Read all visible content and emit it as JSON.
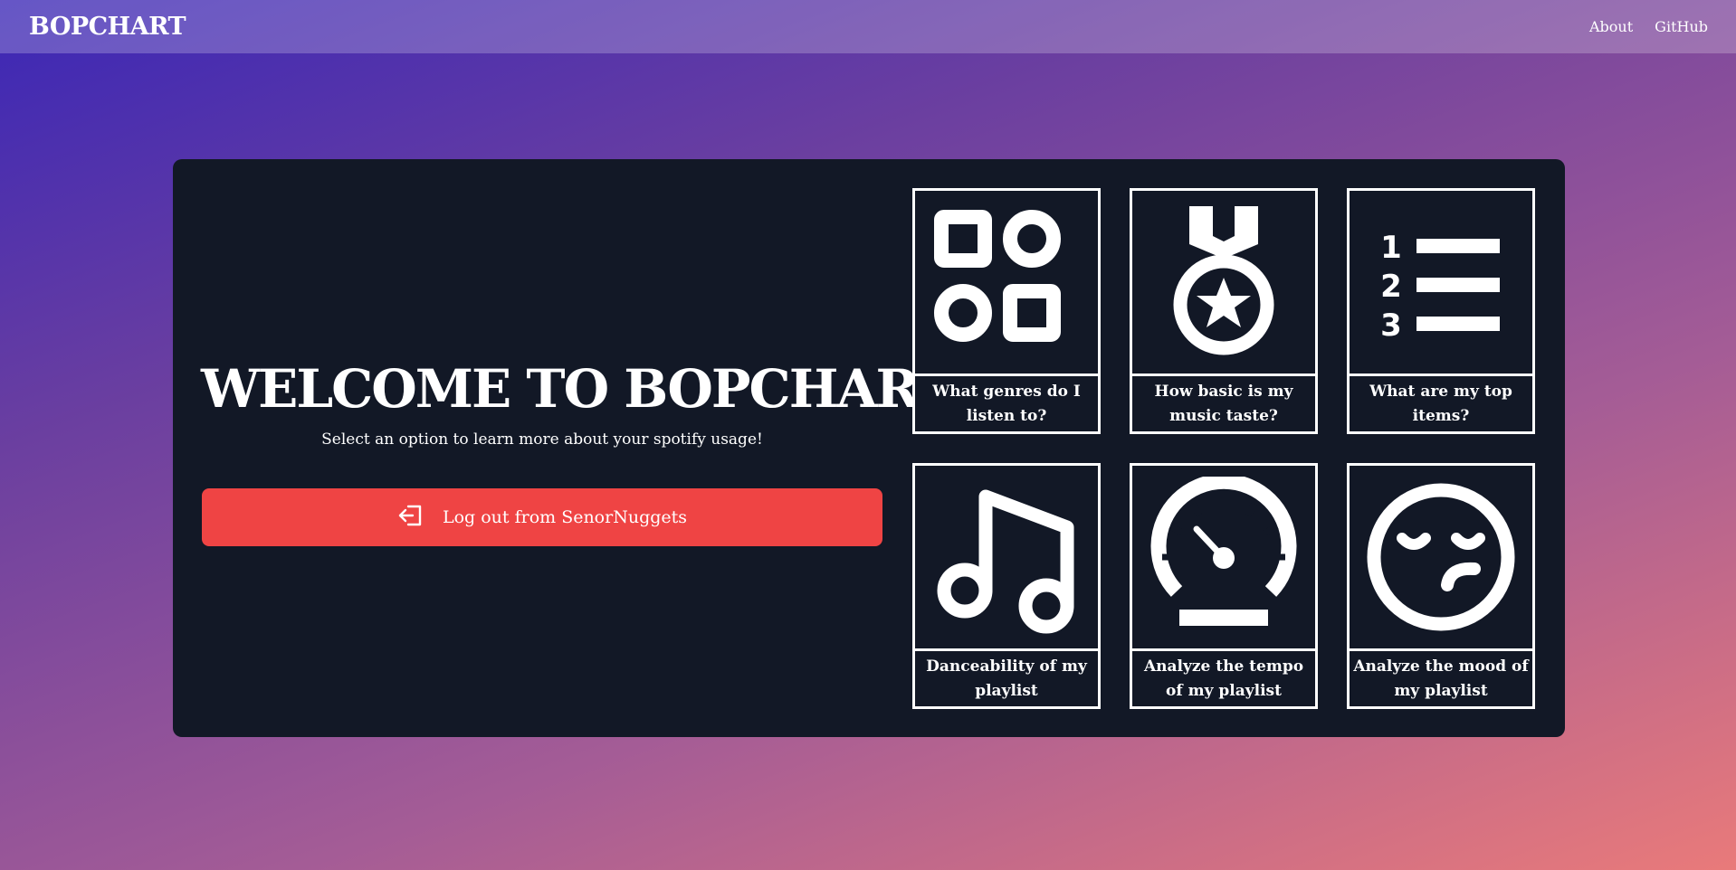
{
  "header": {
    "brand": "BOPCHART",
    "nav": [
      "About",
      "GitHub"
    ]
  },
  "hero": {
    "title": "WELCOME TO BOPCHART",
    "subtitle": "Select an option to learn more about your spotify usage!",
    "logout_label": "Log out from SenorNuggets",
    "logout_icon": "logout-icon"
  },
  "tiles": [
    {
      "label": "What genres do I listen to?",
      "icon": "shapes-icon"
    },
    {
      "label": "How basic is my music taste?",
      "icon": "medal-icon"
    },
    {
      "label": "What are my top items?",
      "icon": "ordered-list-icon"
    },
    {
      "label": "Danceability of my playlist",
      "icon": "music-note-icon"
    },
    {
      "label": "Analyze the tempo of my playlist",
      "icon": "speedometer-icon"
    },
    {
      "label": "Analyze the mood of my playlist",
      "icon": "confused-face-icon"
    }
  ],
  "colors": {
    "panel": "#121826",
    "logout_button": "#ef4444",
    "gradient_start": "#3b27b6",
    "gradient_end": "#e97a7a"
  }
}
